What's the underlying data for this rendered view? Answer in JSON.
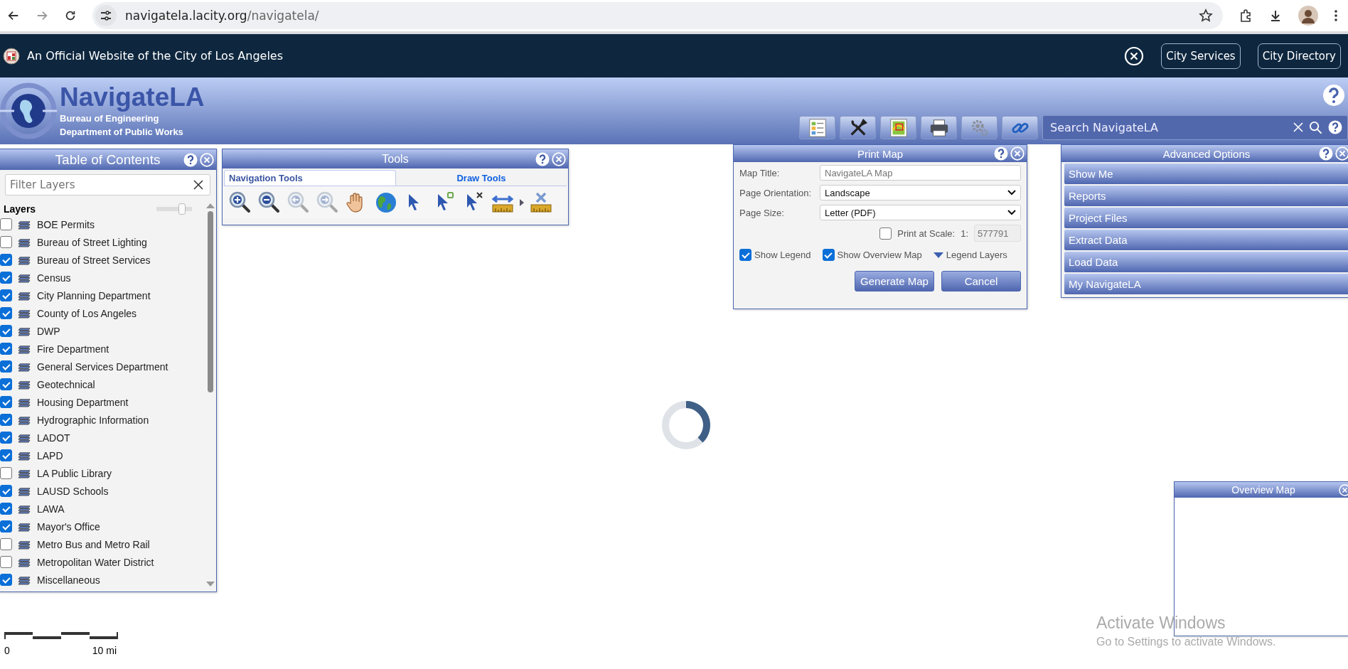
{
  "browser": {
    "url_host": "navigatela.lacity.org",
    "url_path": "/navigatela/"
  },
  "banner": {
    "text": "An Official Website of the City of Los Angeles",
    "buttons": [
      "City Services",
      "City Directory"
    ]
  },
  "header": {
    "title": "NavigateLA",
    "subtitles": [
      "Bureau of Engineering",
      "Department of Public Works"
    ],
    "search": {
      "placeholder": "Search NavigateLA"
    }
  },
  "toc": {
    "title": "Table of Contents",
    "filter": {
      "placeholder": "Filter Layers"
    },
    "layers_label": "Layers",
    "opacity": {
      "level": 0.7
    },
    "layers": [
      {
        "label": "BOE Permits",
        "checked": false
      },
      {
        "label": "Bureau of Street Lighting",
        "checked": false
      },
      {
        "label": "Bureau of Street Services",
        "checked": true
      },
      {
        "label": "Census",
        "checked": true
      },
      {
        "label": "City Planning Department",
        "checked": true
      },
      {
        "label": "County of Los Angeles",
        "checked": true
      },
      {
        "label": "DWP",
        "checked": true
      },
      {
        "label": "Fire Department",
        "checked": true
      },
      {
        "label": "General Services Department",
        "checked": true
      },
      {
        "label": "Geotechnical",
        "checked": true
      },
      {
        "label": "Housing Department",
        "checked": true
      },
      {
        "label": "Hydrographic Information",
        "checked": true
      },
      {
        "label": "LADOT",
        "checked": true
      },
      {
        "label": "LAPD",
        "checked": true
      },
      {
        "label": "LA Public Library",
        "checked": false
      },
      {
        "label": "LAUSD Schools",
        "checked": true
      },
      {
        "label": "LAWA",
        "checked": true
      },
      {
        "label": "Mayor's Office",
        "checked": true
      },
      {
        "label": "Metro Bus and Metro Rail",
        "checked": false
      },
      {
        "label": "Metropolitan Water District",
        "checked": false
      },
      {
        "label": "Miscellaneous",
        "checked": true
      }
    ]
  },
  "tools": {
    "title": "Tools",
    "tabs": [
      {
        "label": "Navigation Tools",
        "selected": true
      },
      {
        "label": "Draw Tools",
        "selected": false
      }
    ],
    "icons": [
      {
        "kind": "zoom-in",
        "disabled": false
      },
      {
        "kind": "zoom-out",
        "disabled": false
      },
      {
        "kind": "zoom-prev",
        "disabled": true
      },
      {
        "kind": "zoom-next",
        "disabled": true
      },
      {
        "kind": "pan",
        "disabled": false
      },
      {
        "kind": "globe",
        "disabled": false
      },
      {
        "kind": "select",
        "disabled": false
      },
      {
        "kind": "select-add",
        "disabled": false
      },
      {
        "kind": "select-remove",
        "disabled": false
      },
      {
        "kind": "measure",
        "disabled": false
      },
      {
        "kind": "measure-clear",
        "disabled": false
      }
    ]
  },
  "print_map": {
    "title": "Print Map",
    "map_title": {
      "label": "Map Title:",
      "placeholder": "NavigateLA Map"
    },
    "orientation": {
      "label": "Page Orientation:",
      "value": "Landscape"
    },
    "page_size": {
      "label": "Page Size:",
      "value": "Letter (PDF)"
    },
    "print_at_scale": {
      "label": "Print at Scale:",
      "checked": false,
      "prefix": "1:",
      "placeholder": "577791"
    },
    "show_legend": {
      "label": "Show Legend",
      "checked": true
    },
    "show_overview": {
      "label": "Show Overview Map",
      "checked": true
    },
    "legend_layers": "Legend Layers",
    "buttons": [
      "Generate Map",
      "Cancel"
    ]
  },
  "advanced_options": {
    "title": "Advanced Options",
    "items": [
      "Show Me",
      "Reports",
      "Project Files",
      "Extract Data",
      "Load Data",
      "My NavigateLA"
    ]
  },
  "overview_map": {
    "title": "Overview Map"
  },
  "scale_bar": {
    "start": "0",
    "end": "10 mi"
  },
  "os_notice": {
    "title": "Activate Windows",
    "text": "Go to Settings to activate Windows."
  }
}
